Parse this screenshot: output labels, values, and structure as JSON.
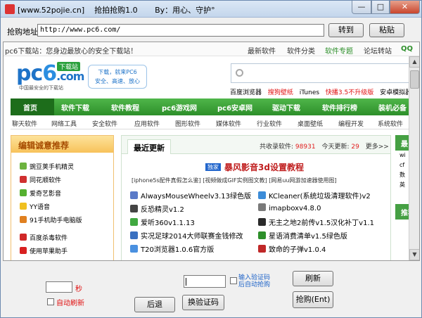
{
  "window": {
    "title": "[www.52pojie.cn]    抢拍抢购1.0       By：用心、守护°",
    "controls": {
      "min": "—",
      "max": "□",
      "close": "✕"
    }
  },
  "urlbar": {
    "label": "抢购地址:",
    "value": "http://www.pc6.com/",
    "goto_label": "转到",
    "paste_label": "粘贴"
  },
  "site": {
    "welcome": "pc6下载站：您身边最放心的安全下载站！",
    "top_links": [
      "最新软件",
      "软件分类",
      "软件专题",
      "论坛转站",
      "QQ"
    ],
    "logo": {
      "text_a": "pc",
      "text_b": "6",
      "text_c": ".com",
      "badge": "下载站",
      "tagline": "中国最安全的下载站"
    },
    "slogan": [
      "下载，就来PC6",
      "安全、高速、放心"
    ],
    "hot_links": [
      "百度浏览器",
      "搜狗壁纸",
      "iTunes",
      "快播3.5不升级版",
      "安卓模拟器"
    ],
    "main_nav": [
      "首页",
      "软件下载",
      "软件教程",
      "pc6游戏网",
      "pc6安卓网",
      "驱动下载",
      "软件排行榜",
      "装机必备"
    ],
    "sub_nav": [
      "聊天软件",
      "网络工具",
      "安全软件",
      "应用软件",
      "图形软件",
      "媒体软件",
      "行业软件",
      "桌面壁纸",
      "编程开发",
      "系统软件"
    ],
    "editor_pick": {
      "title": "编辑诚意推荐",
      "items": [
        "豌豆荚手机精灵",
        "同花顺软件",
        "爱奇艺影音",
        "YY语音",
        "91手机助手电脑版",
        "百度杀毒软件",
        "使用苹果助手"
      ]
    },
    "latest": {
      "tab": "最近更新",
      "total_label": "共收录软件:",
      "total_value": "98931",
      "today_label": "今天更新:",
      "today_value": "29",
      "more": "更多>>",
      "hot_tag": "独家",
      "headline": "暴风影音3d设置教程",
      "subline": "[iphone5s配件真假怎么鉴] [视频做成GIF实例图文教] [网易uu网游加速器使用图]",
      "entries": [
        "AlwaysMouseWheelv3.13绿色版",
        "KCleaner(系统垃圾清理软件)v2",
        "反恐精灵v1.2",
        "imapboxv4.8.0",
        "爱听360v1.1.13",
        "无主之地2前传v1.5汉化补丁v1.1",
        "实况足球2014大师联赛金钱修改",
        "星语消费清单v1.5绿色版",
        "T20浏览器1.0.6官方版",
        "致命的子弹v1.0.4"
      ]
    },
    "right_col": {
      "title": "最",
      "items": [
        "wi",
        "cf",
        "数",
        "英"
      ],
      "title2": "推荐"
    }
  },
  "bottom": {
    "seconds_label": "秒",
    "auto_refresh_label": "自动刷新",
    "input_code_label": "输入验证码",
    "auto_buy_label": "后自动抢购",
    "refresh_label": "刷新",
    "back_label": "后退",
    "change_code_label": "换验证码",
    "buy_label": "抢购(Ent)"
  },
  "colors": {
    "accent_green": "#2d8f2a",
    "accent_red": "#e01010",
    "link_blue": "#1e63c8"
  }
}
